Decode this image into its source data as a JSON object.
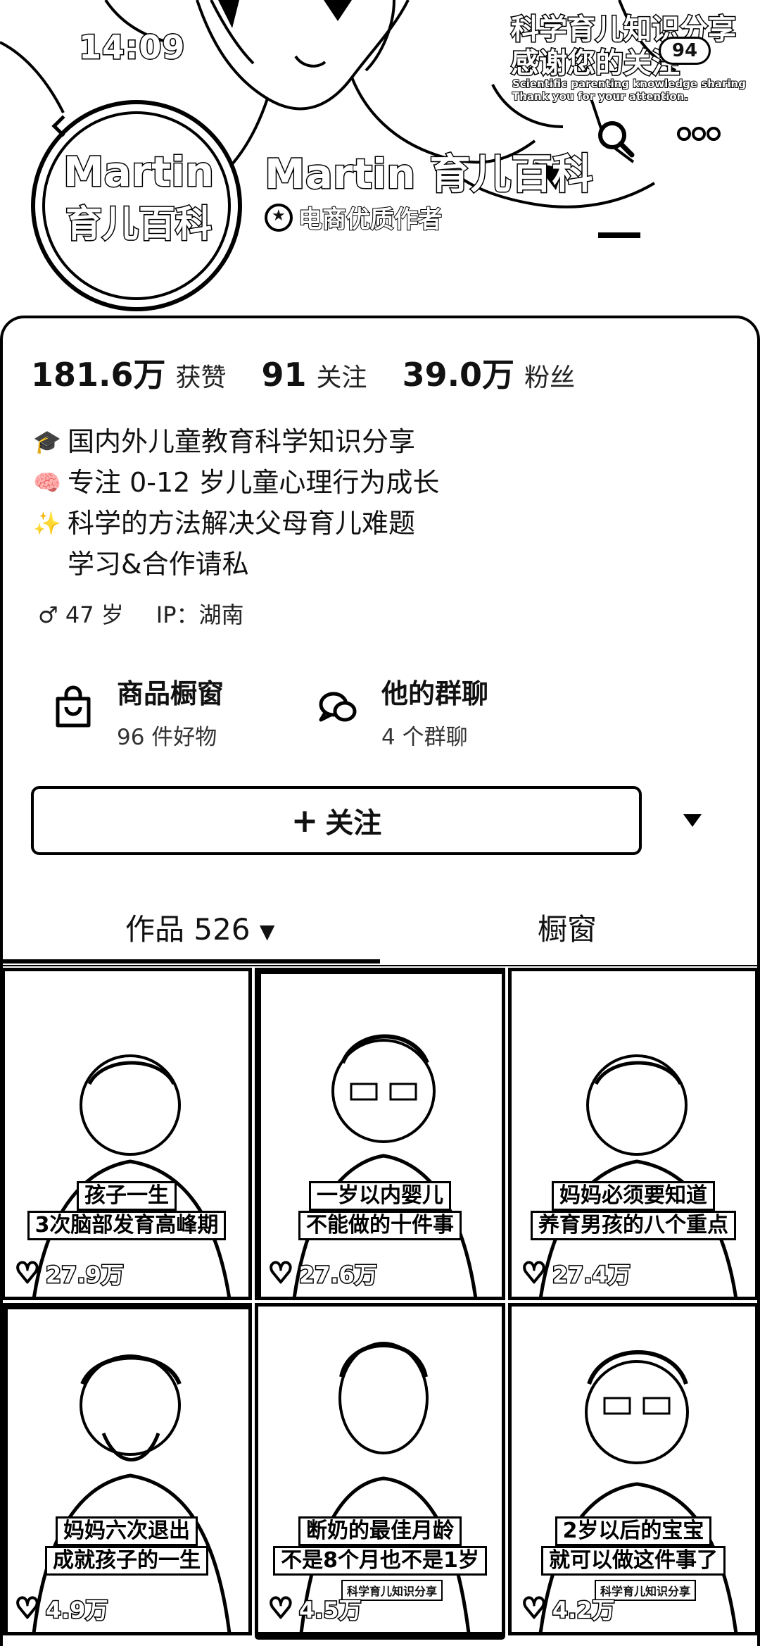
{
  "status_bar": {
    "time": "14:09",
    "badge": "94"
  },
  "banner": {
    "title": "科学育儿知识分享 感谢您的关注",
    "subtitle_line1": "Scientific parenting knowledge sharing",
    "subtitle_line2": "Thank you for your attention."
  },
  "avatar": {
    "line1": "Martin",
    "line2": "育儿百科"
  },
  "profile": {
    "name": "Martin 育儿百科",
    "verification": "电商优质作者"
  },
  "stats": [
    {
      "value": "181.6万",
      "label": "获赞"
    },
    {
      "value": "91",
      "label": "关注"
    },
    {
      "value": "39.0万",
      "label": "粉丝"
    }
  ],
  "bio": [
    {
      "icon": "graduate-icon",
      "glyph": "🎓",
      "text": "国内外儿童教育科学知识分享"
    },
    {
      "icon": "brain-icon",
      "glyph": "🧠",
      "text": "专注 0-12 岁儿童心理行为成长"
    },
    {
      "icon": "sparkle-icon",
      "glyph": "✨",
      "text": "科学的方法解决父母育儿难题"
    },
    {
      "icon": "",
      "glyph": "",
      "text": "学习&合作请私"
    }
  ],
  "meta": {
    "gender_age": "♂ 47 岁",
    "ip": "IP：湖南"
  },
  "entries": {
    "shop": {
      "title": "商品橱窗",
      "sub": "96 件好物"
    },
    "group": {
      "title": "他的群聊",
      "sub": "4 个群聊"
    }
  },
  "follow_button": {
    "label": "关注",
    "plus": "+"
  },
  "tabs": {
    "works": "作品 526",
    "showcase": "橱窗"
  },
  "videos": [
    {
      "caption": [
        "孩子一生",
        "3次脑部发育高峰期"
      ],
      "likes": "27.9万",
      "tag": ""
    },
    {
      "caption": [
        "一岁以内婴儿",
        "不能做的十件事"
      ],
      "likes": "27.6万",
      "tag": ""
    },
    {
      "caption": [
        "妈妈必须要知道",
        "养育男孩的八个重点"
      ],
      "likes": "27.4万",
      "tag": ""
    },
    {
      "caption": [
        "妈妈六次退出",
        "成就孩子的一生"
      ],
      "likes": "4.9万",
      "tag": ""
    },
    {
      "caption": [
        "断奶的最佳月龄",
        "不是8个月也不是1岁"
      ],
      "likes": "4.5万",
      "tag": "科学育儿知识分享"
    },
    {
      "caption": [
        "2岁以后的宝宝",
        "就可以做这件事了"
      ],
      "likes": "4.2万",
      "tag": "科学育儿知识分享"
    }
  ]
}
